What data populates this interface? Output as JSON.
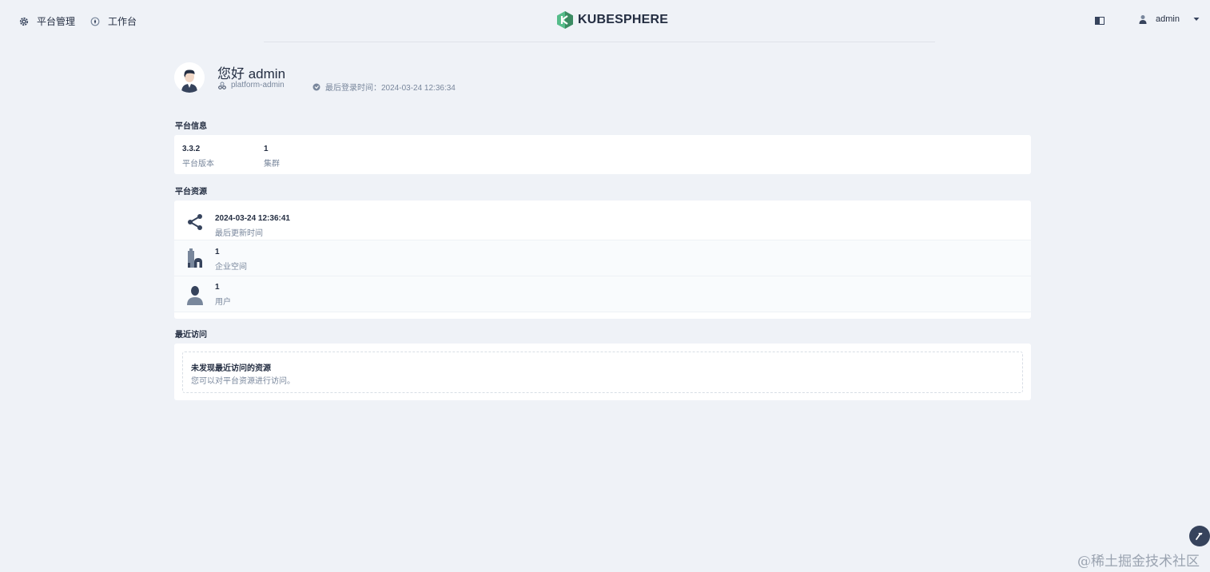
{
  "topnav": {
    "platform_label": "平台管理",
    "workbench_label": "工作台",
    "logo_text": "KUBESPHERE",
    "user_name": "admin"
  },
  "profile": {
    "greeting": "您好 admin",
    "role": "platform-admin",
    "last_login": "最后登录时间：2024-03-24 12:36:34"
  },
  "platform_info": {
    "title": "平台信息",
    "items": [
      {
        "value": "3.3.2",
        "label": "平台版本"
      },
      {
        "value": "1",
        "label": "集群"
      }
    ]
  },
  "platform_resources": {
    "title": "平台资源",
    "items": [
      {
        "value": "2024-03-24 12:36:41",
        "label": "最后更新时间",
        "icon": "share-nodes-icon"
      },
      {
        "value": "1",
        "label": "企业空间",
        "icon": "workspace-icon"
      },
      {
        "value": "1",
        "label": "用户",
        "icon": "user-icon"
      }
    ]
  },
  "recent": {
    "title": "最近访问",
    "empty_title": "未发现最近访问的资源",
    "empty_desc": "您可以对平台资源进行访问。"
  },
  "watermark": "@稀土掘金技术社区",
  "colors": {
    "page_bg": "#eff2f7",
    "card_bg": "#ffffff",
    "text_primary": "#242e42",
    "text_secondary": "#79879c",
    "logo_green": "#55bc8a"
  }
}
